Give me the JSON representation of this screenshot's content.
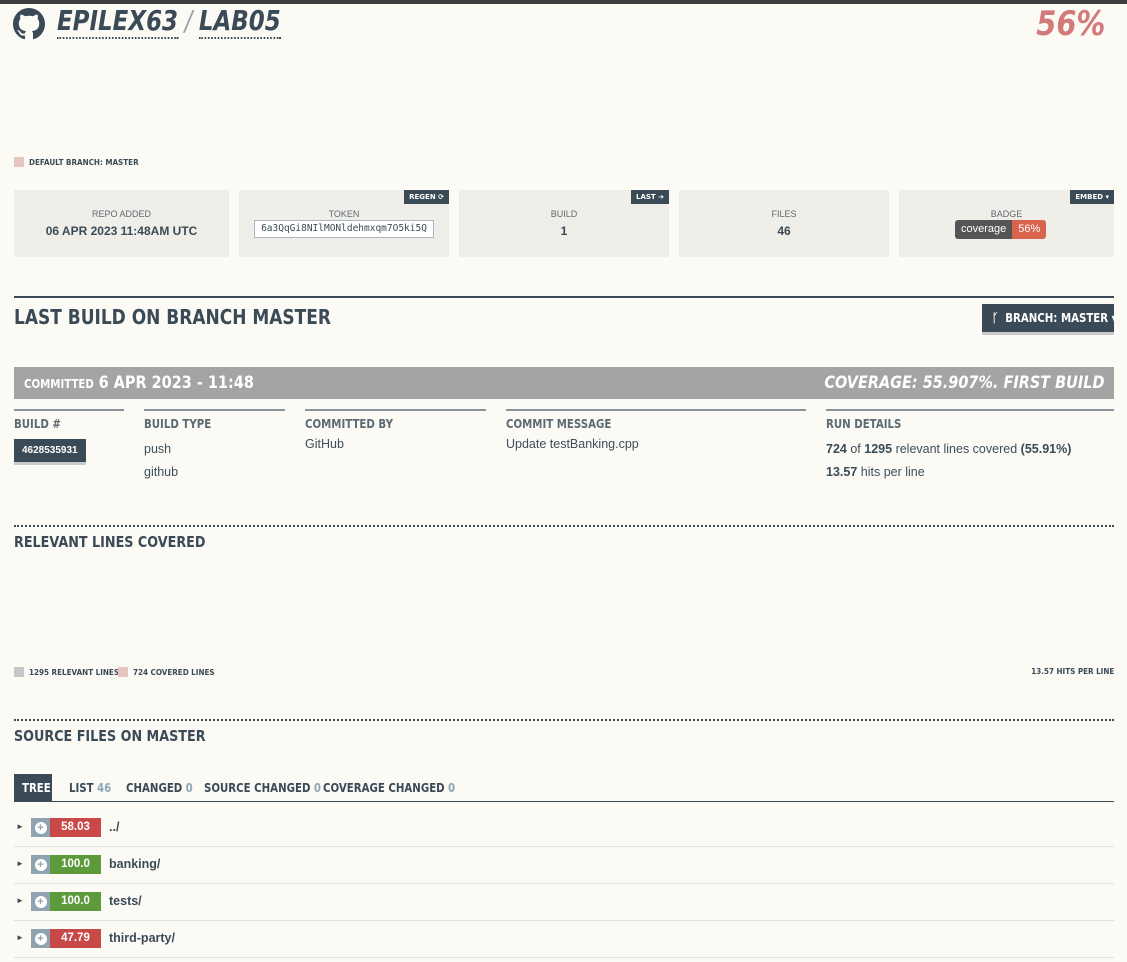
{
  "header": {
    "owner": "EPILEX63",
    "separator": "/",
    "repo": "LAB05",
    "coverage_pct": "56%"
  },
  "default_branch": "DEFAULT BRANCH: MASTER",
  "stats": {
    "repo_added": {
      "label": "REPO ADDED",
      "value": "06 APR 2023 11:48AM UTC"
    },
    "token": {
      "label": "TOKEN",
      "value": "6a3QqGi8NIlMONldehmxqm7O5ki5Q",
      "tag": "REGEN"
    },
    "build": {
      "label": "BUILD",
      "value": "1",
      "tag": "LAST"
    },
    "files": {
      "label": "FILES",
      "value": "46"
    },
    "badge": {
      "label": "BADGE",
      "left": "coverage",
      "right": "56%",
      "tag": "EMBED ▾"
    }
  },
  "last_build": {
    "title": "LAST BUILD ON BRANCH MASTER",
    "branch_button": "BRANCH: MASTER ▾",
    "committed_label": "COMMITTED",
    "committed_date": "6 APR 2023 - 11:48",
    "coverage_text": "COVERAGE: 55.907%. FIRST BUILD"
  },
  "details": {
    "build_num": {
      "header": "BUILD #",
      "value": "4628535931"
    },
    "build_type": {
      "header": "BUILD TYPE",
      "line1": "push",
      "line2": "github"
    },
    "committed_by": {
      "header": "COMMITTED BY",
      "value": "GitHub"
    },
    "commit_message": {
      "header": "COMMIT MESSAGE",
      "value": "Update testBanking.cpp"
    },
    "run_details": {
      "header": "RUN DETAILS",
      "covered": "724",
      "of": "of",
      "relevant": "1295",
      "relevant_text": "relevant lines covered",
      "pct": "(55.91%)",
      "hits": "13.57",
      "hits_text": "hits per line"
    }
  },
  "relevant_lines": {
    "title": "RELEVANT LINES COVERED",
    "legend_relevant": "1295 RELEVANT LINES",
    "legend_covered": "724 COVERED LINES",
    "hits_per_line": "13.57 HITS PER LINE"
  },
  "source_files": {
    "title": "SOURCE FILES ON MASTER",
    "tabs": [
      {
        "label": "TREE",
        "count": ""
      },
      {
        "label": "LIST",
        "count": "46"
      },
      {
        "label": "CHANGED",
        "count": "0"
      },
      {
        "label": "SOURCE CHANGED",
        "count": "0"
      },
      {
        "label": "COVERAGE CHANGED",
        "count": "0"
      }
    ],
    "rows": [
      {
        "coverage": "58.03",
        "name": "../",
        "status": "red"
      },
      {
        "coverage": "100.0",
        "name": "banking/",
        "status": "green"
      },
      {
        "coverage": "100.0",
        "name": "tests/",
        "status": "green"
      },
      {
        "coverage": "47.79",
        "name": "third-party/",
        "status": "red"
      }
    ]
  },
  "colors": {
    "primary": "#3a4a56",
    "low_coverage": "#c94848",
    "high_coverage": "#5c9a3c",
    "badge_accent": "#d9634c",
    "header_pct": "#d37a7a"
  }
}
